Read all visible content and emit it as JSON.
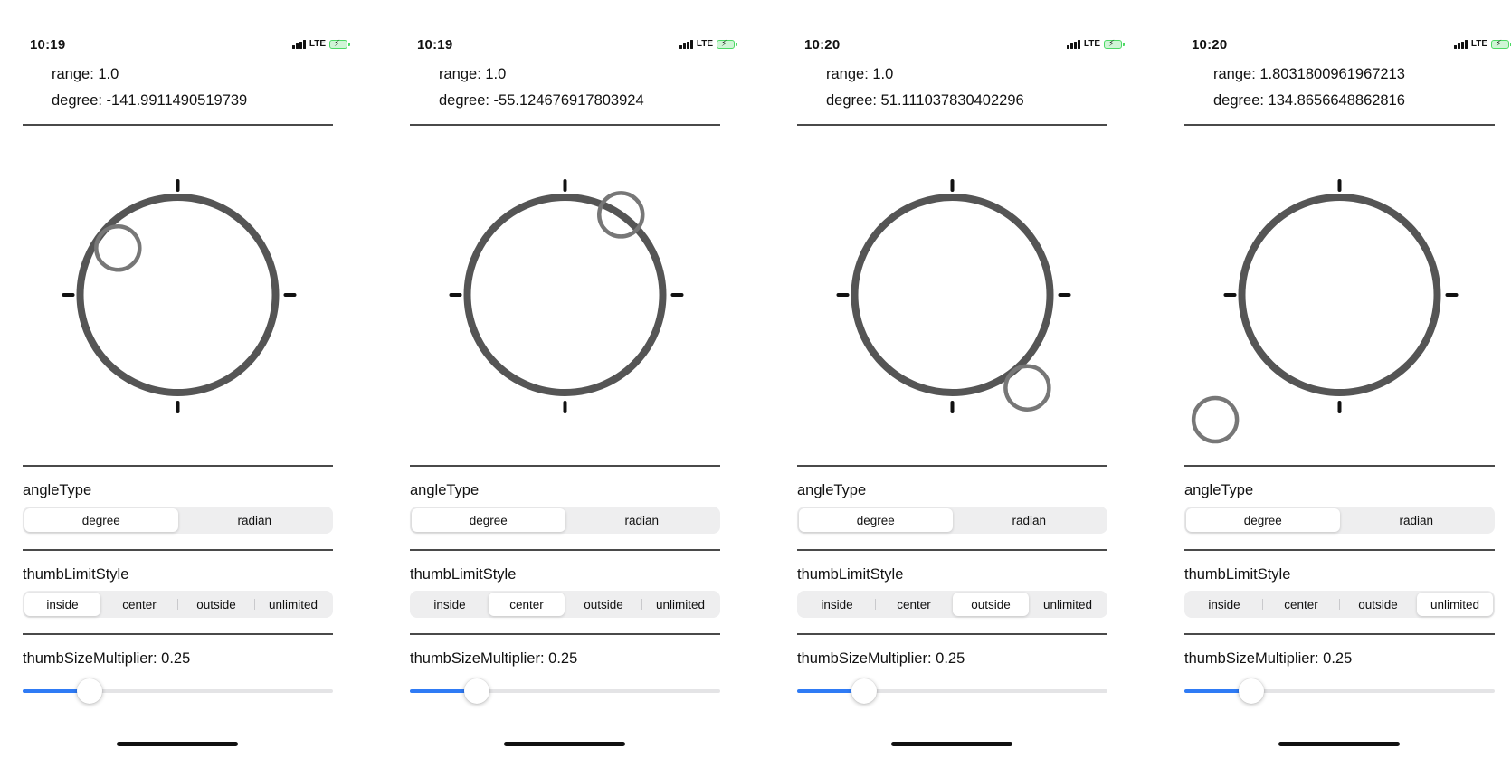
{
  "accent_color": "#2f7bf5",
  "ring_color": "#555555",
  "thumb_color": "#777777",
  "screens": [
    {
      "time": "10:19",
      "network": "LTE",
      "range_text": "range: 1.0",
      "degree_text": "degree: -141.9911490519739",
      "thumb_angle_degrees": -141.9911490519739,
      "thumb_limit_style": "inside",
      "angle_type_label": "angleType",
      "angle_types": [
        "degree",
        "radian"
      ],
      "angle_type_selected": 0,
      "thumb_limit_label": "thumbLimitStyle",
      "thumb_limit_styles": [
        "inside",
        "center",
        "outside",
        "unlimited"
      ],
      "thumb_limit_selected": 0,
      "multiplier_text": "thumbSizeMultiplier: 0.25",
      "multiplier_value": 0.25
    },
    {
      "time": "10:19",
      "network": "LTE",
      "range_text": "range: 1.0",
      "degree_text": "degree: -55.124676917803924",
      "thumb_angle_degrees": -55.124676917803924,
      "thumb_limit_style": "center",
      "angle_type_label": "angleType",
      "angle_types": [
        "degree",
        "radian"
      ],
      "angle_type_selected": 0,
      "thumb_limit_label": "thumbLimitStyle",
      "thumb_limit_styles": [
        "inside",
        "center",
        "outside",
        "unlimited"
      ],
      "thumb_limit_selected": 1,
      "multiplier_text": "thumbSizeMultiplier: 0.25",
      "multiplier_value": 0.25
    },
    {
      "time": "10:20",
      "network": "LTE",
      "range_text": "range: 1.0",
      "degree_text": "degree: 51.111037830402296",
      "thumb_angle_degrees": 51.111037830402296,
      "thumb_limit_style": "outside",
      "angle_type_label": "angleType",
      "angle_types": [
        "degree",
        "radian"
      ],
      "angle_type_selected": 0,
      "thumb_limit_label": "thumbLimitStyle",
      "thumb_limit_styles": [
        "inside",
        "center",
        "outside",
        "unlimited"
      ],
      "thumb_limit_selected": 2,
      "multiplier_text": "thumbSizeMultiplier: 0.25",
      "multiplier_value": 0.25
    },
    {
      "time": "10:20",
      "network": "LTE",
      "range_text": "range: 1.8031800961967213",
      "degree_text": "degree: 134.8656648862816",
      "thumb_angle_degrees": 134.8656648862816,
      "thumb_limit_style": "unlimited",
      "range_value": 1.8031800961967213,
      "angle_type_label": "angleType",
      "angle_types": [
        "degree",
        "radian"
      ],
      "angle_type_selected": 0,
      "thumb_limit_label": "thumbLimitStyle",
      "thumb_limit_styles": [
        "inside",
        "center",
        "outside",
        "unlimited"
      ],
      "thumb_limit_selected": 3,
      "multiplier_text": "thumbSizeMultiplier: 0.25",
      "multiplier_value": 0.25
    }
  ]
}
